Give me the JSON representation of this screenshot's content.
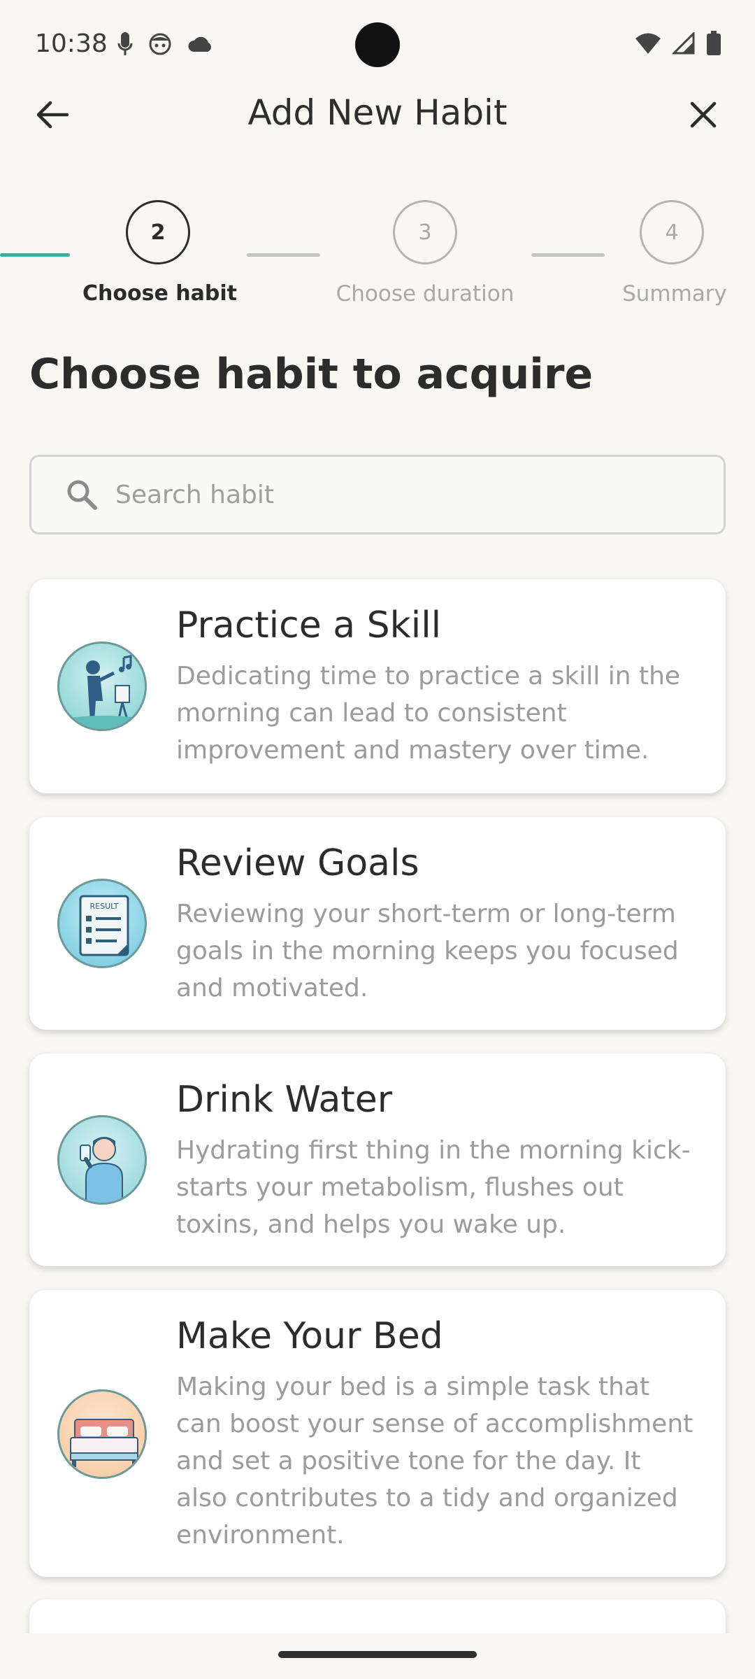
{
  "status_bar": {
    "time": "10:38",
    "icons_left": [
      "mic-icon",
      "face-icon",
      "cloud-icon"
    ],
    "icons_right": [
      "wifi-icon",
      "signal-icon",
      "battery-icon"
    ]
  },
  "header": {
    "title": "Add New Habit",
    "back_icon": "arrow-back-icon",
    "close_icon": "close-icon"
  },
  "stepper": {
    "steps": [
      {
        "number": "2",
        "label": "Choose habit",
        "state": "active"
      },
      {
        "number": "3",
        "label": "Choose duration",
        "state": "inactive"
      },
      {
        "number": "4",
        "label": "Summary",
        "state": "inactive"
      }
    ],
    "colors": {
      "completed_line": "#4aa89d",
      "pending_line": "#c3c3c3"
    }
  },
  "main": {
    "heading": "Choose habit to acquire",
    "search": {
      "placeholder": "Search habit",
      "value": ""
    },
    "habits": [
      {
        "title": "Practice a Skill",
        "description": "Dedicating time to practice a skill in the morning can lead to consistent improvement and mastery over time.",
        "icon": "musician-icon"
      },
      {
        "title": "Review Goals",
        "description": "Reviewing your short-term or long-term goals in the morning keeps you focused and motivated.",
        "icon": "result-document-icon",
        "icon_text": "RESULT"
      },
      {
        "title": "Drink Water",
        "description": "Hydrating first thing in the morning kick-starts your metabolism, flushes out toxins, and helps you wake up.",
        "icon": "drinking-person-icon"
      },
      {
        "title": "Make Your Bed",
        "description": "Making your bed is a simple task that can boost your sense of accomplishment and set a positive tone for the day. It also contributes to a tidy and organized environment.",
        "icon": "bed-icon"
      }
    ]
  }
}
